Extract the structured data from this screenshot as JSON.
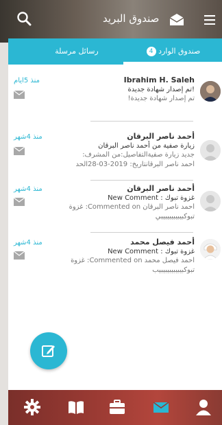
{
  "header": {
    "title": "صندوق البريد",
    "search_icon": "search-icon",
    "menu_icon": "hamburger-icon",
    "brand_icon": "envelope-open-icon"
  },
  "tabs": {
    "inbox_label": "صندوق الوارد",
    "inbox_count": "4",
    "sent_label": "رسائل مرسلة"
  },
  "messages": [
    {
      "time": "منذ 5ايام",
      "sender": "Ibrahim H. Saleh",
      "subject": "!تم إصدار شهادة جديدة",
      "preview": "تم إصدار شهادة جديدة!",
      "preview2": "",
      "avatar": "photo"
    },
    {
      "time": "منذ 4شهر",
      "sender": "أحمد ناصر البرقان",
      "subject": "زيارة صفية من أحمد ناصر البرقان",
      "preview": "جديد زيارة صفيةالتفاصيل:من المشرف:",
      "preview2": "أحمد ناصر البرقانتاريخ: 2019-03-28الحد",
      "avatar": "placeholder"
    },
    {
      "time": "منذ 4شهر",
      "sender": "أحمد ناصر البرقان",
      "subject": "غزوة تبوك : New Comment",
      "preview": "أحمد ناصر البرقان Commented on: غزوة",
      "preview2": "تبوكبيبيبيبيبيبي",
      "avatar": "placeholder"
    },
    {
      "time": "منذ 4شهر",
      "sender": "أحمد فيصل محمد",
      "subject": "غزوة تبوك : New Comment",
      "preview": "أحمد فيصل محمد Commented on: غزوة",
      "preview2": "تبوكبيبيبيبيبيبيب",
      "avatar": "cartoon"
    }
  ],
  "colors": {
    "accent": "#2bb7d3",
    "topbar": "#5a5048",
    "bottombar": "#9a3a33"
  },
  "nav": [
    "gear-icon",
    "book-icon",
    "briefcase-icon",
    "mail-icon",
    "user-icon"
  ],
  "fab_icon": "compose-icon"
}
